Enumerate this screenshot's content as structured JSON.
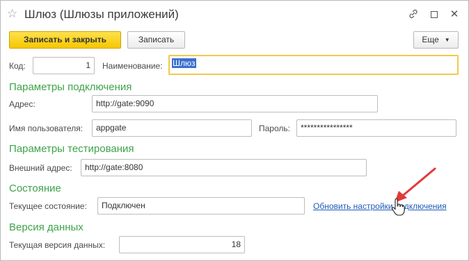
{
  "window": {
    "title": "Шлюз (Шлюзы приложений)",
    "star_glyph": "☆",
    "link_glyph": "🔗",
    "close_glyph": "✕"
  },
  "toolbar": {
    "save_close_label": "Записать и закрыть",
    "save_label": "Записать",
    "more_label": "Еще",
    "more_caret": "▼"
  },
  "header_fields": {
    "code_label": "Код:",
    "code_value": "1",
    "name_label": "Наименование:",
    "name_value": "Шлюз"
  },
  "connection": {
    "section_title": "Параметры подключения",
    "address_label": "Адрес:",
    "address_value": "http://gate:9090",
    "username_label": "Имя пользователя:",
    "username_value": "appgate",
    "password_label": "Пароль:",
    "password_value": "****************"
  },
  "testing": {
    "section_title": "Параметры тестирования",
    "external_address_label": "Внешний адрес:",
    "external_address_value": "http://gate:8080"
  },
  "state": {
    "section_title": "Состояние",
    "current_state_label": "Текущее состояние:",
    "current_state_value": "Подключен",
    "refresh_link_label": "Обновить настройки подключения"
  },
  "data_version": {
    "section_title": "Версия данных",
    "current_version_label": "Текущая версия данных:",
    "current_version_value": "18"
  },
  "colors": {
    "accent_yellow": "#f5c700",
    "section_green": "#3ea34a",
    "link_blue": "#1f5bb7",
    "annotation_red": "#e03a3a"
  }
}
